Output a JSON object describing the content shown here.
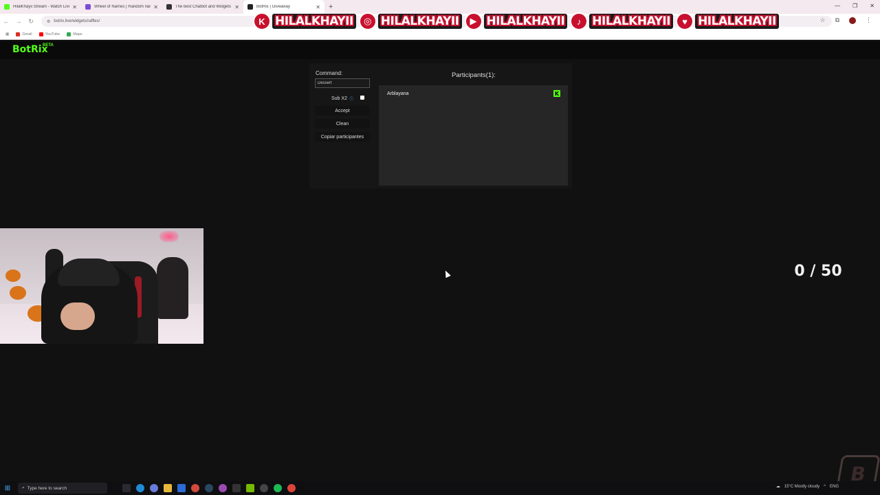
{
  "browser": {
    "tabs": [
      {
        "label": "HilalKhayii Stream - Watch Live",
        "color": "#53fc18",
        "active": false
      },
      {
        "label": "Wheel of Names | Random name picker",
        "color": "#7b4cd6",
        "active": false
      },
      {
        "label": "The best Chatbot and Widgets",
        "color": "#333333",
        "active": false
      },
      {
        "label": "BotRix | Giveaway",
        "color": "#222222",
        "active": true
      }
    ],
    "url": "botrix.live/widgets/raffles/",
    "bookmarks": [
      {
        "label": "Gmail",
        "color": "#d93025"
      },
      {
        "label": "YouTube",
        "color": "#ff0000"
      },
      {
        "label": "Maps",
        "color": "#34a853"
      }
    ]
  },
  "social_banner": {
    "items": [
      {
        "icon": "kick-icon",
        "glyph": "K",
        "handle": "HILALKHAYII"
      },
      {
        "icon": "instagram-icon",
        "glyph": "◎",
        "handle": "HILALKHAYII"
      },
      {
        "icon": "youtube-icon",
        "glyph": "▶",
        "handle": "HILALKHAYII"
      },
      {
        "icon": "tiktok-icon",
        "glyph": "♪",
        "handle": "HILALKHAYII"
      },
      {
        "icon": "twitter-icon",
        "glyph": "♥",
        "handle": "HILALKHAYII"
      }
    ]
  },
  "site": {
    "logo": "BotRix",
    "logo_badge": "BETA"
  },
  "raffle": {
    "command_label": "Command:",
    "command_value": "Dessert",
    "sub_label": "Sub X2",
    "sub_checked": true,
    "buttons": {
      "accept": "Accept",
      "clean": "Clean",
      "copy": "Copiar participantes"
    },
    "participants_title": "Participants(1):",
    "participants": [
      {
        "name": "Arblayana",
        "platform": "kick-icon"
      }
    ]
  },
  "counter": "0 / 50",
  "taskbar": {
    "search_placeholder": "Type here to search",
    "weather": "15°C  Mostly cloudy",
    "lang": "ENG"
  },
  "colors": {
    "kick_green": "#53fc18",
    "banner_red": "#c8102e",
    "background": "#111111"
  }
}
